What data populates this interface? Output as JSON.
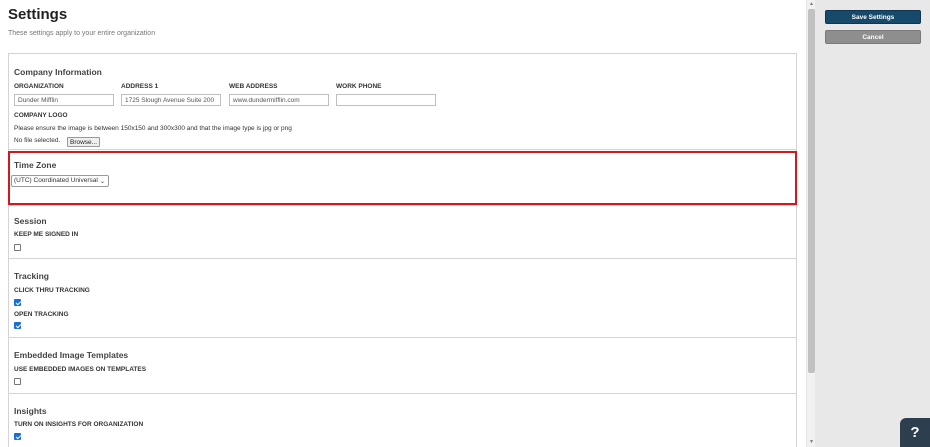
{
  "page": {
    "title": "Settings",
    "subtitle": "These settings apply to your entire organization"
  },
  "company": {
    "title": "Company Information",
    "org_label": "ORGANIZATION",
    "org_value": "Dunder Mifflin",
    "address_label": "ADDRESS 1",
    "address_value": "1725 Slough Avenue Suite 200",
    "web_label": "WEB ADDRESS",
    "web_value": "www.dundermifflin.com",
    "phone_label": "WORK PHONE",
    "phone_value": "",
    "logo_label": "COMPANY LOGO",
    "logo_hint": "Please ensure the image is between 150x150 and 300x300 and that the image type is jpg or png",
    "file_status": "No file selected.",
    "browse_label": "Browse..."
  },
  "timezone": {
    "title": "Time Zone",
    "selected": "(UTC) Coordinated Universal"
  },
  "session": {
    "title": "Session",
    "keep_label": "KEEP ME SIGNED IN",
    "keep_checked": false
  },
  "tracking": {
    "title": "Tracking",
    "click_label": "CLICK THRU TRACKING",
    "click_checked": true,
    "open_label": "OPEN TRACKING",
    "open_checked": true
  },
  "embedded": {
    "title": "Embedded Image Templates",
    "use_label": "USE EMBEDDED IMAGES ON TEMPLATES",
    "use_checked": false
  },
  "insights": {
    "title": "Insights",
    "turn_on_label": "TURN ON INSIGHTS FOR ORGANIZATION",
    "turn_on_checked": true
  },
  "actions": {
    "save_label": "Save Settings",
    "cancel_label": "Cancel",
    "help_label": "?"
  },
  "colors": {
    "save_button": "#17496b",
    "cancel_button": "#8e8e8e",
    "highlight_border": "#d6161d",
    "checkbox_checked": "#1a6fd6",
    "help_button": "#2d3e4f"
  }
}
